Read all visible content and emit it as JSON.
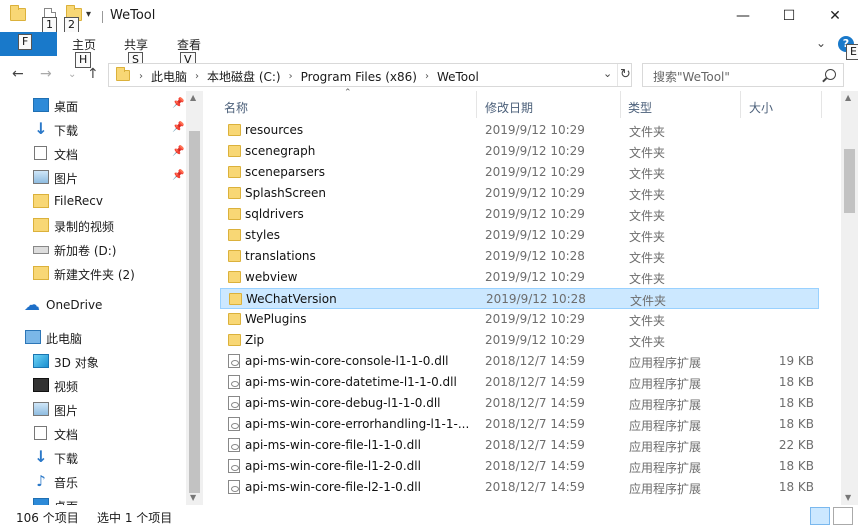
{
  "window": {
    "title": "WeTool",
    "controls": {
      "minimize": "—",
      "maximize": "☐",
      "close": "✕"
    }
  },
  "quick_access": {
    "keytips": [
      "1",
      "2"
    ]
  },
  "ribbon": {
    "file_keytip": "F",
    "tabs": [
      {
        "label": "主页",
        "keytip": "H"
      },
      {
        "label": "共享",
        "keytip": "S"
      },
      {
        "label": "查看",
        "keytip": "V"
      }
    ],
    "help_keytip": "E"
  },
  "address_bar": {
    "breadcrumbs": [
      "此电脑",
      "本地磁盘 (C:)",
      "Program Files (x86)",
      "WeTool"
    ],
    "search_placeholder": "搜索\"WeTool\""
  },
  "nav_pane": {
    "items": [
      {
        "label": "桌面",
        "icon": "desktop-icon",
        "pinned": true
      },
      {
        "label": "下载",
        "icon": "download-icon",
        "pinned": true
      },
      {
        "label": "文档",
        "icon": "documents-icon",
        "pinned": true
      },
      {
        "label": "图片",
        "icon": "pictures-icon",
        "pinned": true
      },
      {
        "label": "FileRecv",
        "icon": "folder-icon",
        "pinned": false
      },
      {
        "label": "录制的视频",
        "icon": "folder-icon",
        "pinned": false
      },
      {
        "label": "新加卷 (D:)",
        "icon": "drive-icon",
        "pinned": false
      },
      {
        "label": "新建文件夹 (2)",
        "icon": "folder-icon",
        "pinned": false
      },
      {
        "label": "OneDrive",
        "icon": "onedrive-icon",
        "pinned": false
      },
      {
        "label": "此电脑",
        "icon": "this-pc-icon",
        "pinned": false
      },
      {
        "label": "3D 对象",
        "icon": "3d-objects-icon",
        "pinned": false
      },
      {
        "label": "视频",
        "icon": "videos-icon",
        "pinned": false
      },
      {
        "label": "图片",
        "icon": "pictures-icon",
        "pinned": false
      },
      {
        "label": "文档",
        "icon": "documents-icon",
        "pinned": false
      },
      {
        "label": "下载",
        "icon": "download-icon",
        "pinned": false
      },
      {
        "label": "音乐",
        "icon": "music-icon",
        "pinned": false
      },
      {
        "label": "桌面",
        "icon": "desktop-icon",
        "pinned": false
      }
    ]
  },
  "file_list": {
    "columns": [
      "名称",
      "修改日期",
      "类型",
      "大小"
    ],
    "rows": [
      {
        "name": "resources",
        "date": "2019/9/12 10:29",
        "type": "文件夹",
        "size": "",
        "kind": "folder"
      },
      {
        "name": "scenegraph",
        "date": "2019/9/12 10:29",
        "type": "文件夹",
        "size": "",
        "kind": "folder"
      },
      {
        "name": "sceneparsers",
        "date": "2019/9/12 10:29",
        "type": "文件夹",
        "size": "",
        "kind": "folder"
      },
      {
        "name": "SplashScreen",
        "date": "2019/9/12 10:29",
        "type": "文件夹",
        "size": "",
        "kind": "folder"
      },
      {
        "name": "sqldrivers",
        "date": "2019/9/12 10:29",
        "type": "文件夹",
        "size": "",
        "kind": "folder"
      },
      {
        "name": "styles",
        "date": "2019/9/12 10:29",
        "type": "文件夹",
        "size": "",
        "kind": "folder"
      },
      {
        "name": "translations",
        "date": "2019/9/12 10:28",
        "type": "文件夹",
        "size": "",
        "kind": "folder"
      },
      {
        "name": "webview",
        "date": "2019/9/12 10:29",
        "type": "文件夹",
        "size": "",
        "kind": "folder"
      },
      {
        "name": "WeChatVersion",
        "date": "2019/9/12 10:28",
        "type": "文件夹",
        "size": "",
        "kind": "folder",
        "selected": true
      },
      {
        "name": "WePlugins",
        "date": "2019/9/12 10:29",
        "type": "文件夹",
        "size": "",
        "kind": "folder"
      },
      {
        "name": "Zip",
        "date": "2019/9/12 10:29",
        "type": "文件夹",
        "size": "",
        "kind": "folder"
      },
      {
        "name": "api-ms-win-core-console-l1-1-0.dll",
        "date": "2018/12/7 14:59",
        "type": "应用程序扩展",
        "size": "19 KB",
        "kind": "dll"
      },
      {
        "name": "api-ms-win-core-datetime-l1-1-0.dll",
        "date": "2018/12/7 14:59",
        "type": "应用程序扩展",
        "size": "18 KB",
        "kind": "dll"
      },
      {
        "name": "api-ms-win-core-debug-l1-1-0.dll",
        "date": "2018/12/7 14:59",
        "type": "应用程序扩展",
        "size": "18 KB",
        "kind": "dll"
      },
      {
        "name": "api-ms-win-core-errorhandling-l1-1-...",
        "date": "2018/12/7 14:59",
        "type": "应用程序扩展",
        "size": "18 KB",
        "kind": "dll"
      },
      {
        "name": "api-ms-win-core-file-l1-1-0.dll",
        "date": "2018/12/7 14:59",
        "type": "应用程序扩展",
        "size": "22 KB",
        "kind": "dll"
      },
      {
        "name": "api-ms-win-core-file-l1-2-0.dll",
        "date": "2018/12/7 14:59",
        "type": "应用程序扩展",
        "size": "18 KB",
        "kind": "dll"
      },
      {
        "name": "api-ms-win-core-file-l2-1-0.dll",
        "date": "2018/12/7 14:59",
        "type": "应用程序扩展",
        "size": "18 KB",
        "kind": "dll"
      }
    ]
  },
  "status_bar": {
    "item_count": "106 个项目",
    "selection": "选中 1 个项目"
  }
}
